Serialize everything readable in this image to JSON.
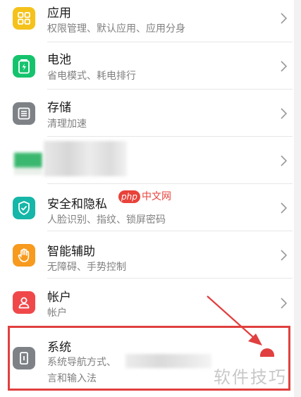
{
  "settings": {
    "items": [
      {
        "title": "应用",
        "subtitle": "权限管理、默认应用、应用分身",
        "icon": "apps-grid-icon",
        "color": "#f5c21b"
      },
      {
        "title": "电池",
        "subtitle": "省电模式、耗电排行",
        "icon": "battery-icon",
        "color": "#16c36d"
      },
      {
        "title": "存储",
        "subtitle": "清理加速",
        "icon": "storage-icon",
        "color": "#7e8287"
      },
      {
        "title": "",
        "subtitle": "",
        "icon": "blurred-icon",
        "color": "#3bb86f"
      },
      {
        "title": "安全和隐私",
        "subtitle": "人脸识别、指纹、锁屏密码",
        "icon": "shield-icon",
        "color": "#16b6a8"
      },
      {
        "title": "智能辅助",
        "subtitle": "无障碍、手势控制",
        "icon": "hand-icon",
        "color": "#f79a1e"
      },
      {
        "title": "帐户",
        "subtitle": "帐户",
        "icon": "person-icon",
        "color": "#f0484a"
      },
      {
        "title": "系统",
        "subtitle": "系统导航方式、",
        "subtitle2": "言和输入法",
        "icon": "phone-icon",
        "color": "#7e8287"
      }
    ]
  },
  "overlay": {
    "php_logo": "php",
    "php_site": "中文网",
    "watermark": "软件技巧",
    "highlight_color": "#e0403f"
  }
}
